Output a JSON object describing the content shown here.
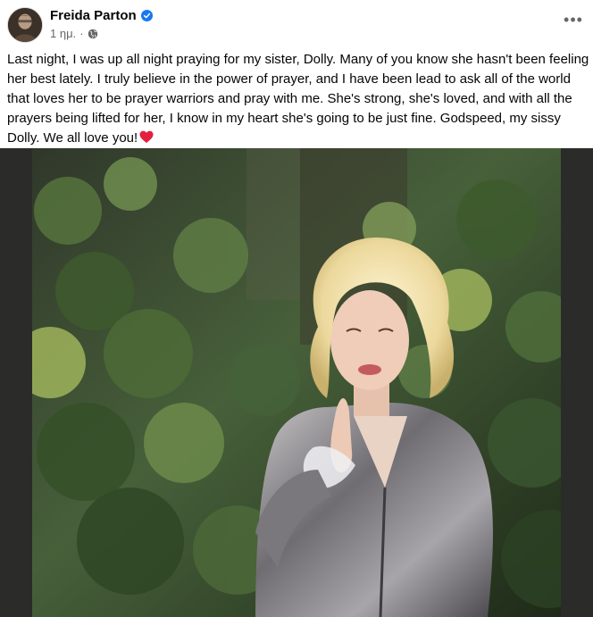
{
  "post": {
    "author": {
      "name": "Freida Parton",
      "verified": true,
      "avatar_icon": "profile-photo"
    },
    "meta": {
      "timestamp": "1 ημ.",
      "separator": "·",
      "audience_icon": "globe-icon"
    },
    "more_button_label": "•••",
    "text": "Last night, I was up all night praying for my sister, Dolly. Many of you know she hasn't been feeling her best lately. I truly believe in the power of prayer, and I have been lead to ask all of the world that loves her to be prayer warriors and pray with me. She's strong, she's loved, and with all the prayers being lifted for her, I know in my heart she's going to be just fine. Godspeed, my sissy Dolly. We all love you!",
    "text_emoji": "red-heart",
    "photo": {
      "description_icon": "woman-praying-in-garden-photo"
    }
  },
  "colors": {
    "text_primary": "#050505",
    "text_secondary": "#65676b",
    "verified_blue": "#1877f2",
    "heart_red": "#e41e3f",
    "photo_letterbox": "#2b2b2a"
  }
}
